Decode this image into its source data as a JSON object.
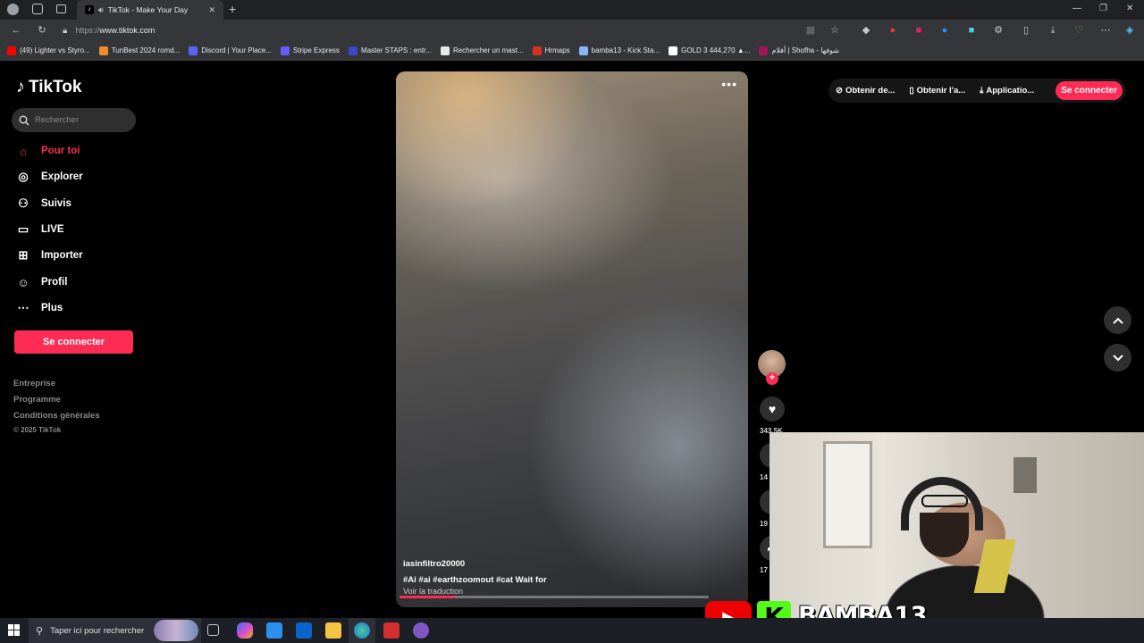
{
  "browser": {
    "tab_title": "TikTok - Make Your Day",
    "new_tab_symbol": "+",
    "url_prefix": "https://",
    "url_host": "www.tiktok.com",
    "bookmarks": [
      {
        "label": "(49) Lighter vs Styro...",
        "color": "#ff0000"
      },
      {
        "label": "TunBest 2024 romd...",
        "color": "#f28c28"
      },
      {
        "label": "Discord | Your Place...",
        "color": "#5865f2"
      },
      {
        "label": "Stripe Express",
        "color": "#635bff"
      },
      {
        "label": "Master STAPS : entr...",
        "color": "#3a48c4"
      },
      {
        "label": "Rechercher un mast...",
        "color": "#e8e8e8"
      },
      {
        "label": "Hrmaps",
        "color": "#d93025"
      },
      {
        "label": "bamba13 - Kick Sta...",
        "color": "#8ab4f8"
      },
      {
        "label": "GOLD 3 444,270 ▲...",
        "color": "#ffffff"
      },
      {
        "label": "أفلام | Shofha - شوفها",
        "color": "#a0165a"
      }
    ]
  },
  "tiktok": {
    "brand": "TikTok",
    "search_placeholder": "Rechercher",
    "nav": [
      {
        "label": "Pour toi",
        "icon": "home-icon"
      },
      {
        "label": "Explorer",
        "icon": "compass-icon"
      },
      {
        "label": "Suivis",
        "icon": "following-icon"
      },
      {
        "label": "LIVE",
        "icon": "live-icon"
      },
      {
        "label": "Importer",
        "icon": "upload-icon"
      },
      {
        "label": "Profil",
        "icon": "profile-icon"
      },
      {
        "label": "Plus",
        "icon": "more-icon"
      }
    ],
    "login_label": "Se connecter",
    "footer": [
      "Entreprise",
      "Programme",
      "Conditions générales"
    ],
    "copyright": "© 2025 TikTok",
    "top_actions": {
      "coins": "Obtenir de...",
      "app": "Obtenir l'a...",
      "desktop": "Applicatio...",
      "login": "Se connecter"
    },
    "video": {
      "author": "iasinfiltro20000",
      "caption": "#Ai  #ai  #earthzoomout  #cat  Wait for",
      "translate": "Voir la traduction",
      "progress": 0.18,
      "like_count": "343.5K",
      "comment_count": "14",
      "save_count": "19",
      "share_count": "17"
    }
  },
  "overlay": {
    "streamer_name": "BAMBA13",
    "kick_letter": "K"
  },
  "taskbar": {
    "search_placeholder": "Taper ici pour rechercher"
  }
}
